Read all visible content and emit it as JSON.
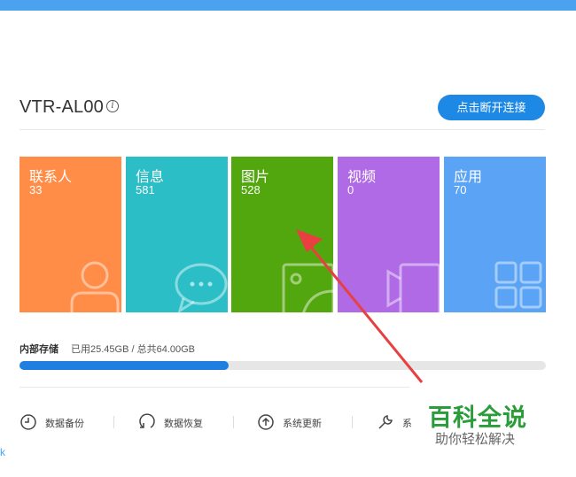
{
  "device": {
    "name": "VTR-AL00",
    "info_icon": "info-circle-icon",
    "disconnect_label": "点击断开连接"
  },
  "tiles": [
    {
      "label": "联系人",
      "count": "33",
      "color": "#ff8c47",
      "icon": "contact-person-icon"
    },
    {
      "label": "信息",
      "count": "581",
      "color": "#2bbec7",
      "icon": "chat-bubble-icon"
    },
    {
      "label": "图片",
      "count": "528",
      "color": "#53a70e",
      "icon": "picture-icon"
    },
    {
      "label": "视频",
      "count": "0",
      "color": "#b06ae6",
      "icon": "video-camera-icon"
    },
    {
      "label": "应用",
      "count": "70",
      "color": "#5aa3f5",
      "icon": "apps-grid-icon"
    }
  ],
  "storage": {
    "label": "内部存储",
    "usage_text": "已用25.45GB / 总共64.00GB",
    "used_fraction": 0.398,
    "bar_color": "#1e7fe0"
  },
  "tools": [
    {
      "label": "数据备份",
      "icon": "backup-clock-icon"
    },
    {
      "label": "数据恢复",
      "icon": "restore-icon"
    },
    {
      "label": "系统更新",
      "icon": "upload-arrow-icon"
    },
    {
      "label": "系",
      "icon": "wrench-icon"
    }
  ],
  "watermark": {
    "main": "百科全说",
    "sub": "助你轻松解决"
  },
  "left_edge_mark": "k",
  "colors": {
    "topbar": "#4ba3f0",
    "button": "#1e88e5",
    "annotation_arrow": "#e84040"
  }
}
